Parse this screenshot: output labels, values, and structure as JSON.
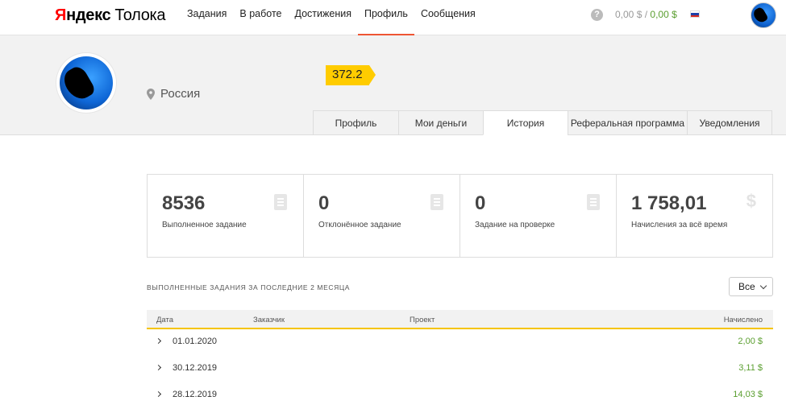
{
  "header": {
    "logo_ya": "Я",
    "logo_ndex": "ндекс",
    "logo_toloka": "Толока",
    "nav": [
      "Задания",
      "В работе",
      "Достижения",
      "Профиль",
      "Сообщения"
    ],
    "active_nav": "Профиль",
    "help": "?",
    "balance_main": "0,00 $",
    "balance_sep": "/",
    "balance_green": "0,00 $",
    "accent_color": "#e53",
    "balance_color": "#5a9e2f"
  },
  "profile": {
    "location": "Россия",
    "rating": "372.2",
    "rating_color": "#ffcc00"
  },
  "tabs": [
    "Профиль",
    "Мои деньги",
    "История",
    "Реферальная программа",
    "Уведомления"
  ],
  "active_tab": "История",
  "stats": [
    {
      "value": "8536",
      "label": "Выполненное задание",
      "icon": "document-icon"
    },
    {
      "value": "0",
      "label": "Отклонённое задание",
      "icon": "document-icon"
    },
    {
      "value": "0",
      "label": "Задание на проверке",
      "icon": "document-icon"
    },
    {
      "value": "1 758,01",
      "label": "Начисления за всё время",
      "icon": "dollar-icon"
    }
  ],
  "history": {
    "title": "ВЫПОЛНЕННЫЕ ЗАДАНИЯ ЗА ПОСЛЕДНИЕ 2 МЕСЯЦА",
    "filter": "Все",
    "columns": {
      "date": "Дата",
      "customer": "Заказчик",
      "project": "Проект",
      "amount": "Начислено"
    },
    "rows": [
      {
        "date": "01.01.2020",
        "amount": "2,00 $"
      },
      {
        "date": "30.12.2019",
        "amount": "3,11 $"
      },
      {
        "date": "28.12.2019",
        "amount": "14,03 $"
      }
    ]
  }
}
